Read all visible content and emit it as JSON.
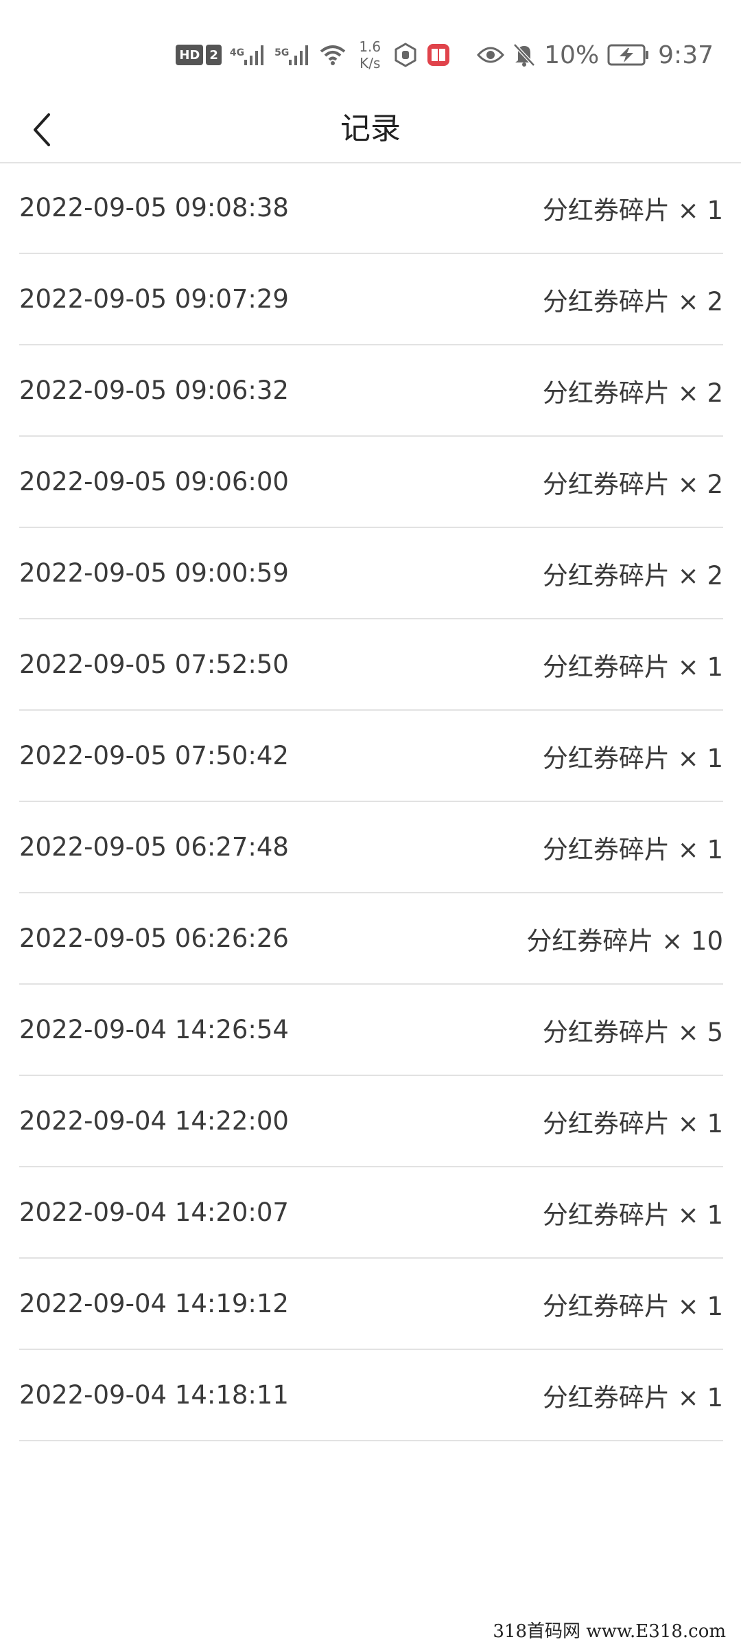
{
  "status_bar": {
    "hd_label": "HD",
    "sim_label": "2",
    "net1_label": "4G",
    "net2_label": "5G",
    "net_speed_value": "1.6",
    "net_speed_unit": "K/s",
    "battery_percent": "10%",
    "time": "9:37"
  },
  "header": {
    "title": "记录"
  },
  "records": [
    {
      "time": "2022-09-05 09:08:38",
      "item": "分红券碎片 × 1"
    },
    {
      "time": "2022-09-05 09:07:29",
      "item": "分红券碎片 × 2"
    },
    {
      "time": "2022-09-05 09:06:32",
      "item": "分红券碎片 × 2"
    },
    {
      "time": "2022-09-05 09:06:00",
      "item": "分红券碎片 × 2"
    },
    {
      "time": "2022-09-05 09:00:59",
      "item": "分红券碎片 × 2"
    },
    {
      "time": "2022-09-05 07:52:50",
      "item": "分红券碎片 × 1"
    },
    {
      "time": "2022-09-05 07:50:42",
      "item": "分红券碎片 × 1"
    },
    {
      "time": "2022-09-05 06:27:48",
      "item": "分红券碎片 × 1"
    },
    {
      "time": "2022-09-05 06:26:26",
      "item": "分红券碎片 × 10"
    },
    {
      "time": "2022-09-04 14:26:54",
      "item": "分红券碎片 × 5"
    },
    {
      "time": "2022-09-04 14:22:00",
      "item": "分红券碎片 × 1"
    },
    {
      "time": "2022-09-04 14:20:07",
      "item": "分红券碎片 × 1"
    },
    {
      "time": "2022-09-04 14:19:12",
      "item": "分红券碎片 × 1"
    },
    {
      "time": "2022-09-04 14:18:11",
      "item": "分红券碎片 × 1"
    }
  ],
  "watermark": "318首码网 www.E318.com",
  "colors": {
    "text": "#3a3a3a",
    "divider": "#e2e2e2",
    "status_icon": "#666666",
    "app_icon_red": "#e0434b"
  },
  "icons": {
    "back": "chevron-left-icon",
    "signal": "signal-bars-icon",
    "wifi": "wifi-icon",
    "eye": "eye-icon",
    "bell_off": "bell-off-icon",
    "battery": "battery-charging-icon"
  }
}
